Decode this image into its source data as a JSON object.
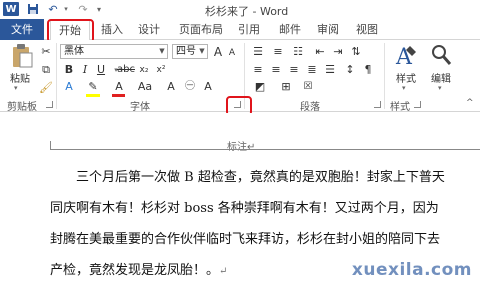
{
  "window": {
    "title": "杉杉来了 - Word",
    "app_badge": "W"
  },
  "quick_access": {
    "save_icon": "save-icon",
    "undo_icon": "undo-icon",
    "redo_icon": "redo-icon"
  },
  "tabs": [
    {
      "label": "文件"
    },
    {
      "label": "开始"
    },
    {
      "label": "插入"
    },
    {
      "label": "设计"
    },
    {
      "label": "页面布局"
    },
    {
      "label": "引用"
    },
    {
      "label": "邮件"
    },
    {
      "label": "审阅"
    },
    {
      "label": "视图"
    }
  ],
  "ribbon": {
    "clipboard": {
      "paste_label": "粘贴",
      "group_label": "剪贴板"
    },
    "font": {
      "font_name": "黑体",
      "font_size": "四号",
      "grow_label": "A",
      "shrink_label": "A",
      "group_label": "字体"
    },
    "paragraph": {
      "group_label": "段落"
    },
    "styles": {
      "styles_label": "样式",
      "group_label": "样式"
    },
    "editing": {
      "edit_label": "编辑"
    }
  },
  "document": {
    "header_label": "标注",
    "lines": [
      "三个月后第一次做 B 超检查，竟然真的是双胞胎！封家上下普天",
      "同庆啊有木有！杉杉对 boss 各种崇拜啊有木有！又过两个月，因为",
      "封腾在美最重要的合作伙伴临时飞来拜访，杉杉在封小姐的陪同下去",
      "产检，竟然发现是龙凤胎！。"
    ],
    "para_mark": "↵"
  },
  "watermark": "xuexila.com"
}
